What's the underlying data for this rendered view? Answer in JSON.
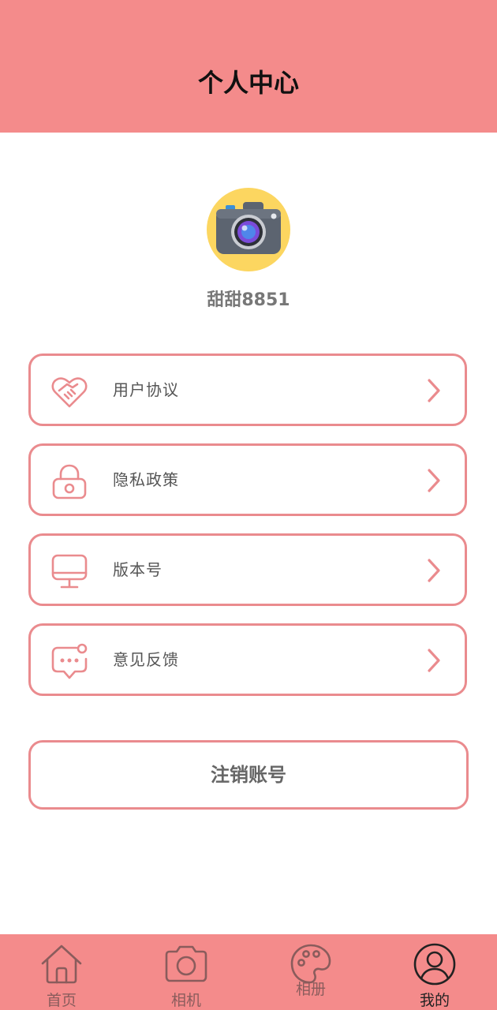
{
  "header": {
    "title": "个人中心"
  },
  "profile": {
    "username": "甜甜8851",
    "avatar_icon": "camera-icon"
  },
  "menu": {
    "items": [
      {
        "label": "用户协议",
        "icon": "handshake-heart-icon"
      },
      {
        "label": "隐私政策",
        "icon": "lock-icon"
      },
      {
        "label": "版本号",
        "icon": "monitor-icon"
      },
      {
        "label": "意见反馈",
        "icon": "feedback-chat-icon"
      }
    ]
  },
  "logout": {
    "label": "注销账号"
  },
  "tabbar": {
    "items": [
      {
        "label": "首页",
        "icon": "home-icon",
        "active": false
      },
      {
        "label": "相机",
        "icon": "camera-icon",
        "active": false
      },
      {
        "label": "相册",
        "icon": "palette-icon",
        "active": false
      },
      {
        "label": "我的",
        "icon": "user-icon",
        "active": true
      }
    ]
  },
  "colors": {
    "header_bg": "#f48b8b",
    "accent_border": "#ea8b8e",
    "avatar_bg": "#fcd660",
    "tab_inactive": "#8a5c5c",
    "tab_active": "#222222"
  }
}
